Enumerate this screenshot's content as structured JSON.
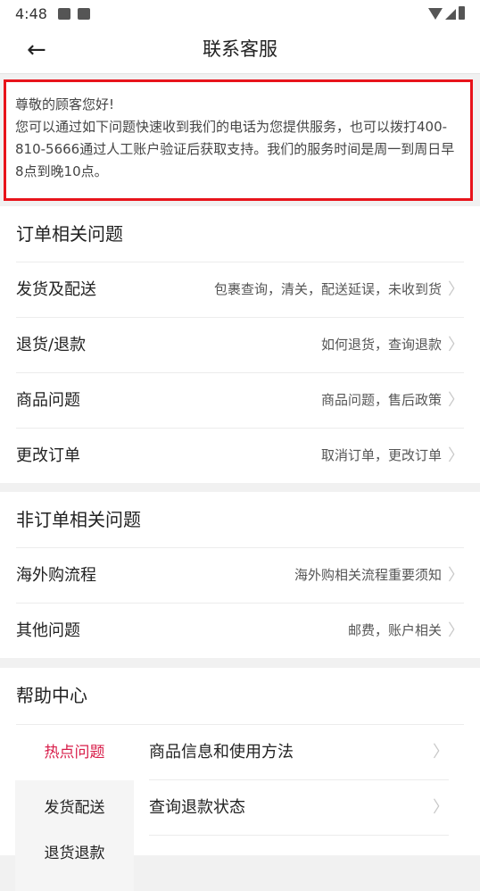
{
  "status": {
    "time": "4:48"
  },
  "header": {
    "back_icon": "←",
    "title": "联系客服"
  },
  "notice": {
    "greeting": "尊敬的顾客您好!",
    "body": "您可以通过如下问题快速收到我们的电话为您提供服务，也可以拨打400-810-5666通过人工账户验证后获取支持。我们的服务时间是周一到周日早8点到晚10点。"
  },
  "order_section": {
    "title": "订单相关问题",
    "items": [
      {
        "label": "发货及配送",
        "hint": "包裹查询，清关，配送延误，未收到货"
      },
      {
        "label": "退货/退款",
        "hint": "如何退货，查询退款"
      },
      {
        "label": "商品问题",
        "hint": "商品问题，售后政策"
      },
      {
        "label": "更改订单",
        "hint": "取消订单，更改订单"
      }
    ]
  },
  "nonorder_section": {
    "title": "非订单相关问题",
    "items": [
      {
        "label": "海外购流程",
        "hint": "海外购相关流程重要须知"
      },
      {
        "label": "其他问题",
        "hint": "邮费，账户相关"
      }
    ]
  },
  "help_center": {
    "title": "帮助中心",
    "categories": [
      "热点问题",
      "发货配送",
      "退货退款"
    ],
    "active_category_color": "#d81e4a",
    "questions": [
      "商品信息和使用方法",
      "查询退款状态"
    ]
  },
  "colors": {
    "notice_border": "#e8141b"
  }
}
